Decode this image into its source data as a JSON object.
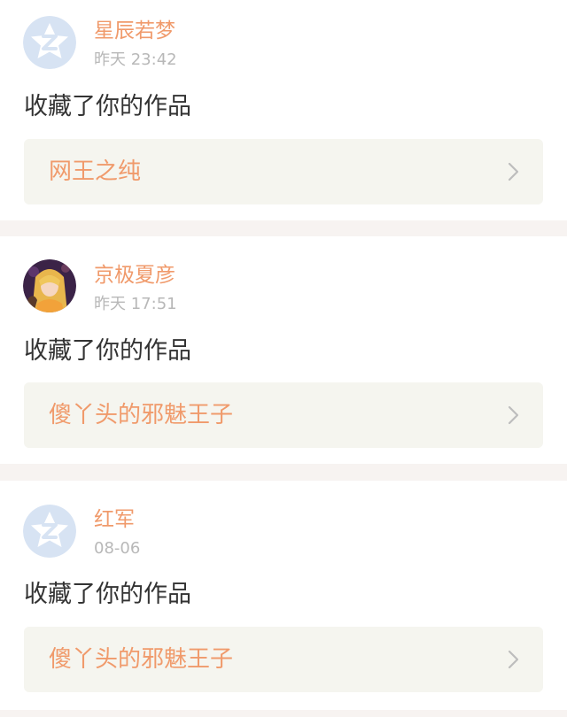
{
  "notifications": [
    {
      "username": "星辰若梦",
      "time": "昨天 23:42",
      "action": "收藏了你的作品",
      "work_title": "网王之纯",
      "avatar": "default-avatar-icon"
    },
    {
      "username": "京极夏彦",
      "time": "昨天 17:51",
      "action": "收藏了你的作品",
      "work_title": "傻丫头的邪魅王子",
      "avatar": "anime-character-avatar"
    },
    {
      "username": "红军",
      "time": "08-06",
      "action": "收藏了你的作品",
      "work_title": "傻丫头的邪魅王子",
      "avatar": "default-avatar-icon"
    }
  ],
  "colors": {
    "accent": "#f09a6b",
    "text": "#333333",
    "muted": "#b8b8b8",
    "card_background": "#ffffff",
    "link_background": "#f5f5ef",
    "page_background": "#f7f3f1",
    "default_avatar": "#d7e3f3"
  }
}
